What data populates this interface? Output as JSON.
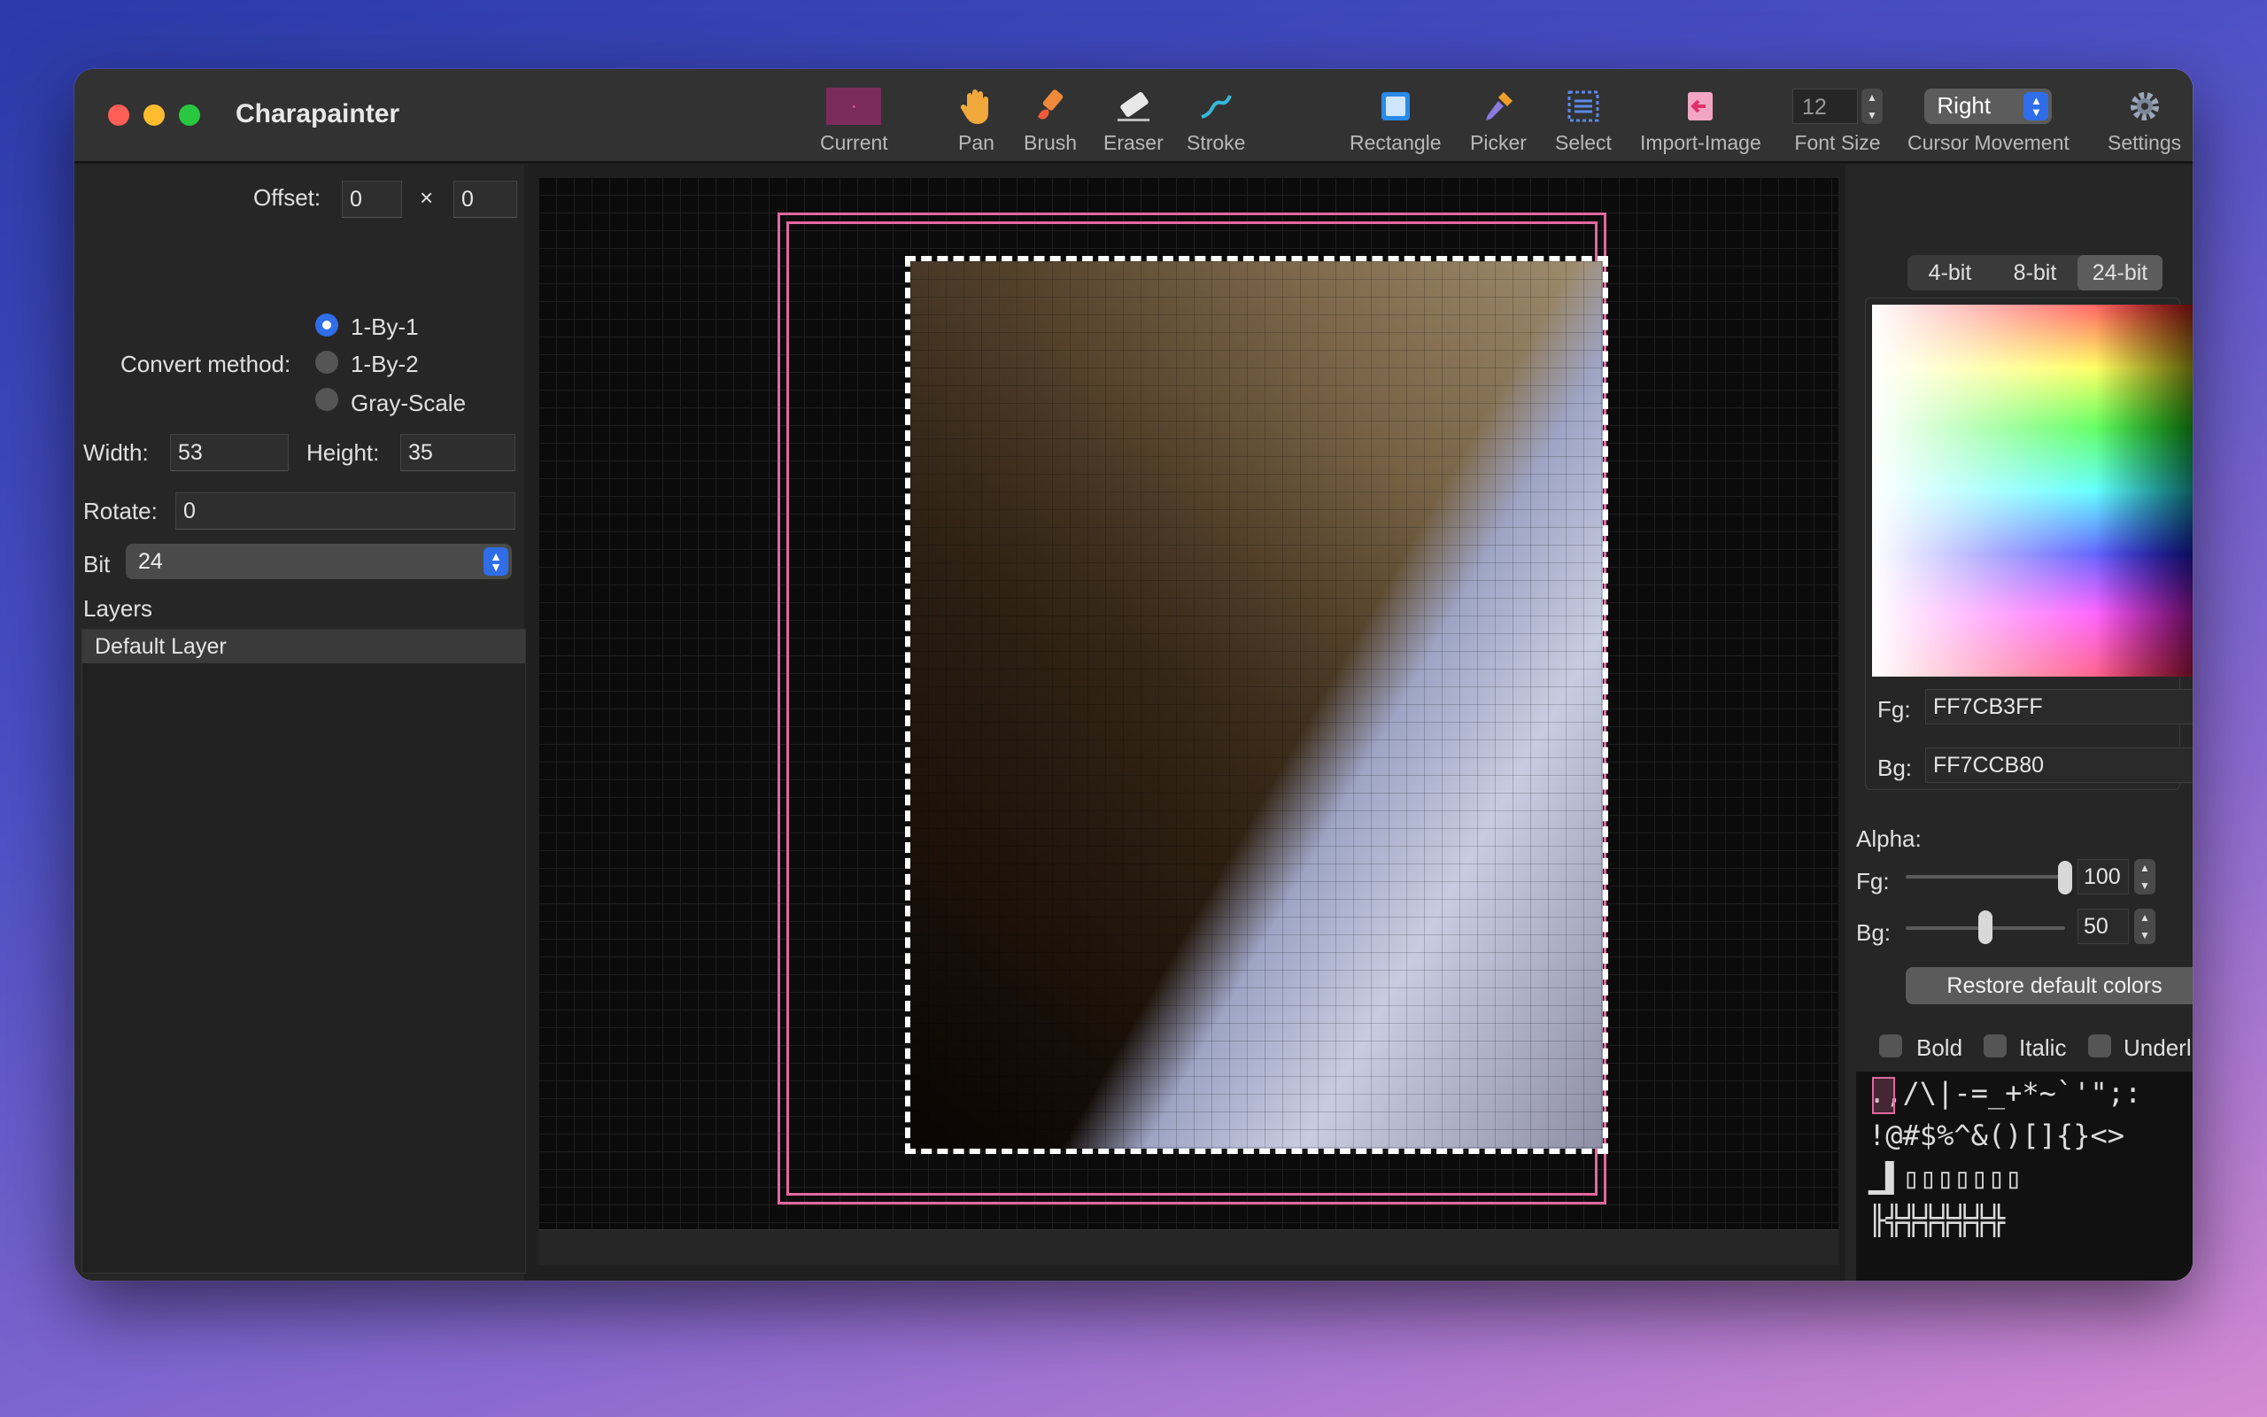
{
  "window": {
    "title": "Charapainter"
  },
  "toolbar": {
    "current_label": "Current",
    "current_color": "#7a2b5b",
    "pan_label": "Pan",
    "brush_label": "Brush",
    "eraser_label": "Eraser",
    "stroke_label": "Stroke",
    "rectangle_label": "Rectangle",
    "picker_label": "Picker",
    "select_label": "Select",
    "import_label": "Import-Image",
    "font_size_value": "12",
    "font_size_label": "Font Size",
    "cursor_value": "Right",
    "cursor_label": "Cursor Movement",
    "settings_label": "Settings"
  },
  "left": {
    "offset_label": "Offset:",
    "offset_x": "0",
    "offset_sep": "×",
    "offset_y": "0",
    "convert_label": "Convert method:",
    "methods": [
      "1-By-1",
      "1-By-2",
      "Gray-Scale"
    ],
    "selected_method": "1-By-1",
    "width_label": "Width:",
    "width_value": "53",
    "height_label": "Height:",
    "height_value": "35",
    "rotate_label": "Rotate:",
    "rotate_value": "0",
    "bit_label": "Bit",
    "bit_value": "24",
    "layers_label": "Layers",
    "layers": [
      "Default Layer"
    ],
    "buttons": [
      "⬆",
      "⬇",
      "+",
      "−"
    ]
  },
  "right": {
    "bit_tabs": [
      "4-bit",
      "8-bit",
      "24-bit"
    ],
    "selected_tab": "24-bit",
    "fg_label": "Fg:",
    "fg_value": "FF7CB3FF",
    "bg_label": "Bg:",
    "bg_value": "FF7CCB80",
    "alpha_label": "Alpha:",
    "alpha_fg_label": "Fg:",
    "alpha_fg_value": "100",
    "alpha_bg_label": "Bg:",
    "alpha_bg_value": "50",
    "restore_label": "Restore default colors",
    "bold_label": "Bold",
    "italic_label": "Italic",
    "underline_label": "Underline",
    "glyph_rows": [
      ".,/\\|-=_+*~`'\";:",
      "!@#$%^&()[]{}<>",
      "▁▌▯▯▯▯▯▯▯",
      "╟╬╬╬╬╬╬╬"
    ]
  }
}
